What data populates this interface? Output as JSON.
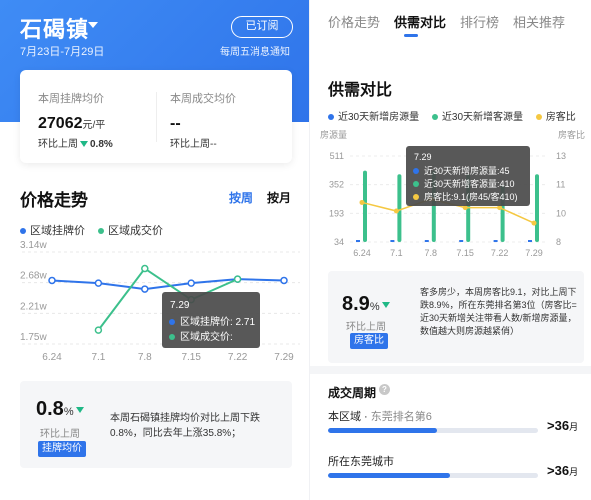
{
  "left": {
    "town": "石碣镇",
    "date_range": "7月23日-7月29日",
    "subscribe_label": "已订阅",
    "notify_text": "每周五消息通知",
    "listing": {
      "label": "本周挂牌均价",
      "value": "27062",
      "unit": "元/平",
      "cmp_label": "环比上周",
      "cmp_value": "0.8%"
    },
    "deal": {
      "label": "本周成交均价",
      "value": "--",
      "cmp_label": "环比上周",
      "cmp_value": "--"
    },
    "section_title": "价格走势",
    "seg_week": "按周",
    "seg_month": "按月",
    "summary_pct": "0.8",
    "summary_pct_sign": "%",
    "summary_sub": "环比上周",
    "summary_tag": "挂牌均价",
    "summary_text": "本周石碣镇挂牌均价对比上周下跌0.8%，同比去年上涨35.8%；"
  },
  "right": {
    "tabs": [
      "价格走势",
      "供需对比",
      "排行榜",
      "相关推荐"
    ],
    "active_tab": 1,
    "section_title": "供需对比",
    "sd_pct": "8.9",
    "sd_pct_sign": "%",
    "sd_sub": "环比上周",
    "sd_tag": "房客比",
    "sd_text": "客多房少，本周房客比9.1，对比上周下跌8.9%，所在东莞排名第3位（房客比=近30天新增关注带看人数/新增房源量，数值越大则房源越紧俏）",
    "deal_title": "成交周期",
    "help_glyph": "?",
    "deal_rows": [
      {
        "label": "本区域 · ",
        "rank": "东莞排名第6",
        "value": ">36",
        "unit": "月",
        "fill_pct": 52
      },
      {
        "label": "所在东莞城市",
        "rank": "",
        "value": ">36",
        "unit": "月",
        "fill_pct": 58
      }
    ]
  },
  "colors": {
    "blue": "#2f74ea",
    "green": "#3cc08c",
    "yellow": "#f5c842",
    "tooltip_bg": "#4a4a4a"
  },
  "chart_data": [
    {
      "type": "line",
      "x": [
        "6.24",
        "7.1",
        "7.8",
        "7.15",
        "7.22",
        "7.29"
      ],
      "y_ticks": [
        "3.14w",
        "2.68w",
        "2.21w",
        "1.75w"
      ],
      "ylim": [
        1.75,
        3.14
      ],
      "series": [
        {
          "name": "区域挂牌价",
          "color": "#2f74ea",
          "values": [
            2.71,
            2.67,
            2.58,
            2.67,
            2.73,
            2.71
          ]
        },
        {
          "name": "区域成交价",
          "color": "#3cc08c",
          "values": [
            null,
            1.96,
            2.89,
            2.42,
            2.73,
            null
          ]
        }
      ],
      "tooltip": {
        "title": "7.29",
        "rows": [
          {
            "label": "区域挂牌价: ",
            "value": "2.71",
            "color": "#2f74ea"
          },
          {
            "label": "区域成交价: ",
            "value": "",
            "color": "#3cc08c"
          }
        ]
      }
    },
    {
      "type": "bar",
      "x": [
        "6.24",
        "7.1",
        "7.8",
        "7.15",
        "7.22",
        "7.29"
      ],
      "ylabel_left": "房源量",
      "ylabel_right": "房客比",
      "y_ticks_left": [
        "511",
        "352",
        "193",
        "34"
      ],
      "y_ticks_right": [
        "13",
        "11",
        "10",
        "8"
      ],
      "ylim_left": [
        34,
        511
      ],
      "ylim_right": [
        8,
        13
      ],
      "series": [
        {
          "name": "近30天新增房源量",
          "color": "#2f74ea",
          "values": [
            45,
            45,
            45,
            45,
            45,
            45
          ]
        },
        {
          "name": "近30天新增客源量",
          "color": "#3cc08c",
          "values": [
            430,
            410,
            430,
            410,
            350,
            410
          ]
        },
        {
          "name": "房客比",
          "color": "#f5c842",
          "values": [
            10.3,
            9.8,
            10.5,
            10.0,
            10.0,
            9.1
          ]
        }
      ],
      "tooltip": {
        "title": "7.29",
        "rows": [
          {
            "label": "近30天新增房源量:",
            "value": "45",
            "color": "#2f74ea"
          },
          {
            "label": "近30天新增客源量:",
            "value": "410",
            "color": "#3cc08c"
          },
          {
            "label": "房客比:",
            "value": "9.1(房45/客410)",
            "color": "#f5c842"
          }
        ]
      }
    }
  ]
}
